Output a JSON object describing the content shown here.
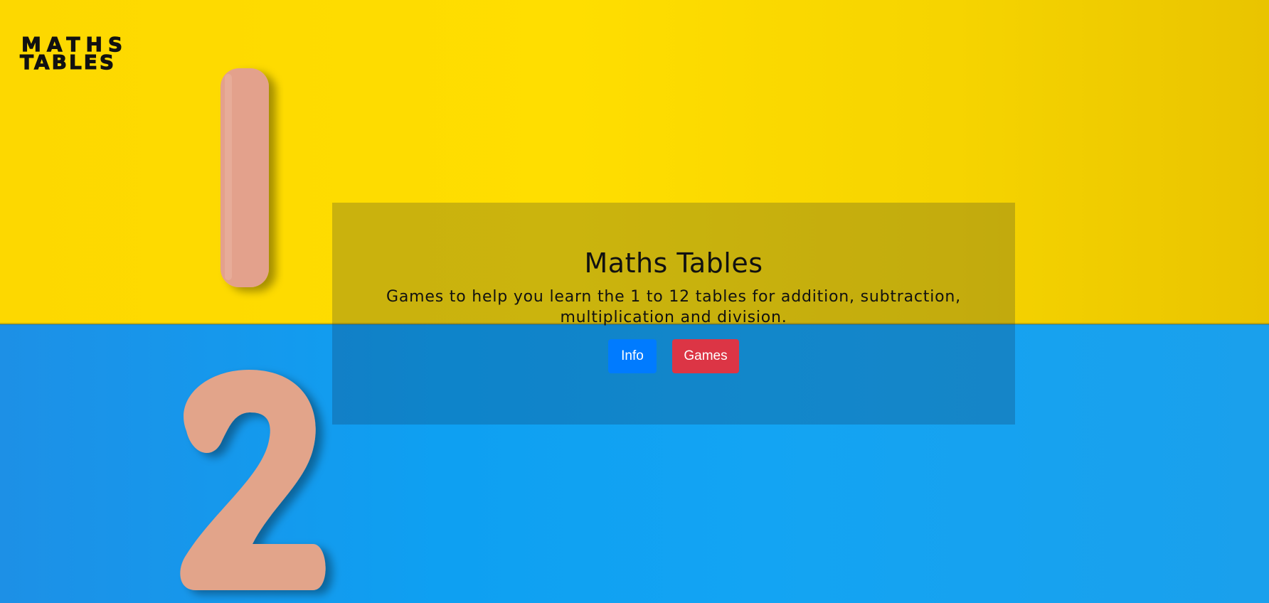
{
  "logo": {
    "line1": "MATHS",
    "line2": "TABLES"
  },
  "hero": {
    "title": "Maths Tables",
    "subtitle": "Games to help you learn the 1 to 12 tables for addition, subtraction, multiplication and division.",
    "buttons": {
      "info_label": "Info",
      "games_label": "Games"
    }
  },
  "colors": {
    "background_top": "#ffde00",
    "background_bottom": "#0ea0f2",
    "info_button": "#007bff",
    "games_button": "#dc3545",
    "digit_cutout": "#e2a48a"
  },
  "background_image": {
    "digits_depicted": [
      "1",
      "2"
    ]
  }
}
